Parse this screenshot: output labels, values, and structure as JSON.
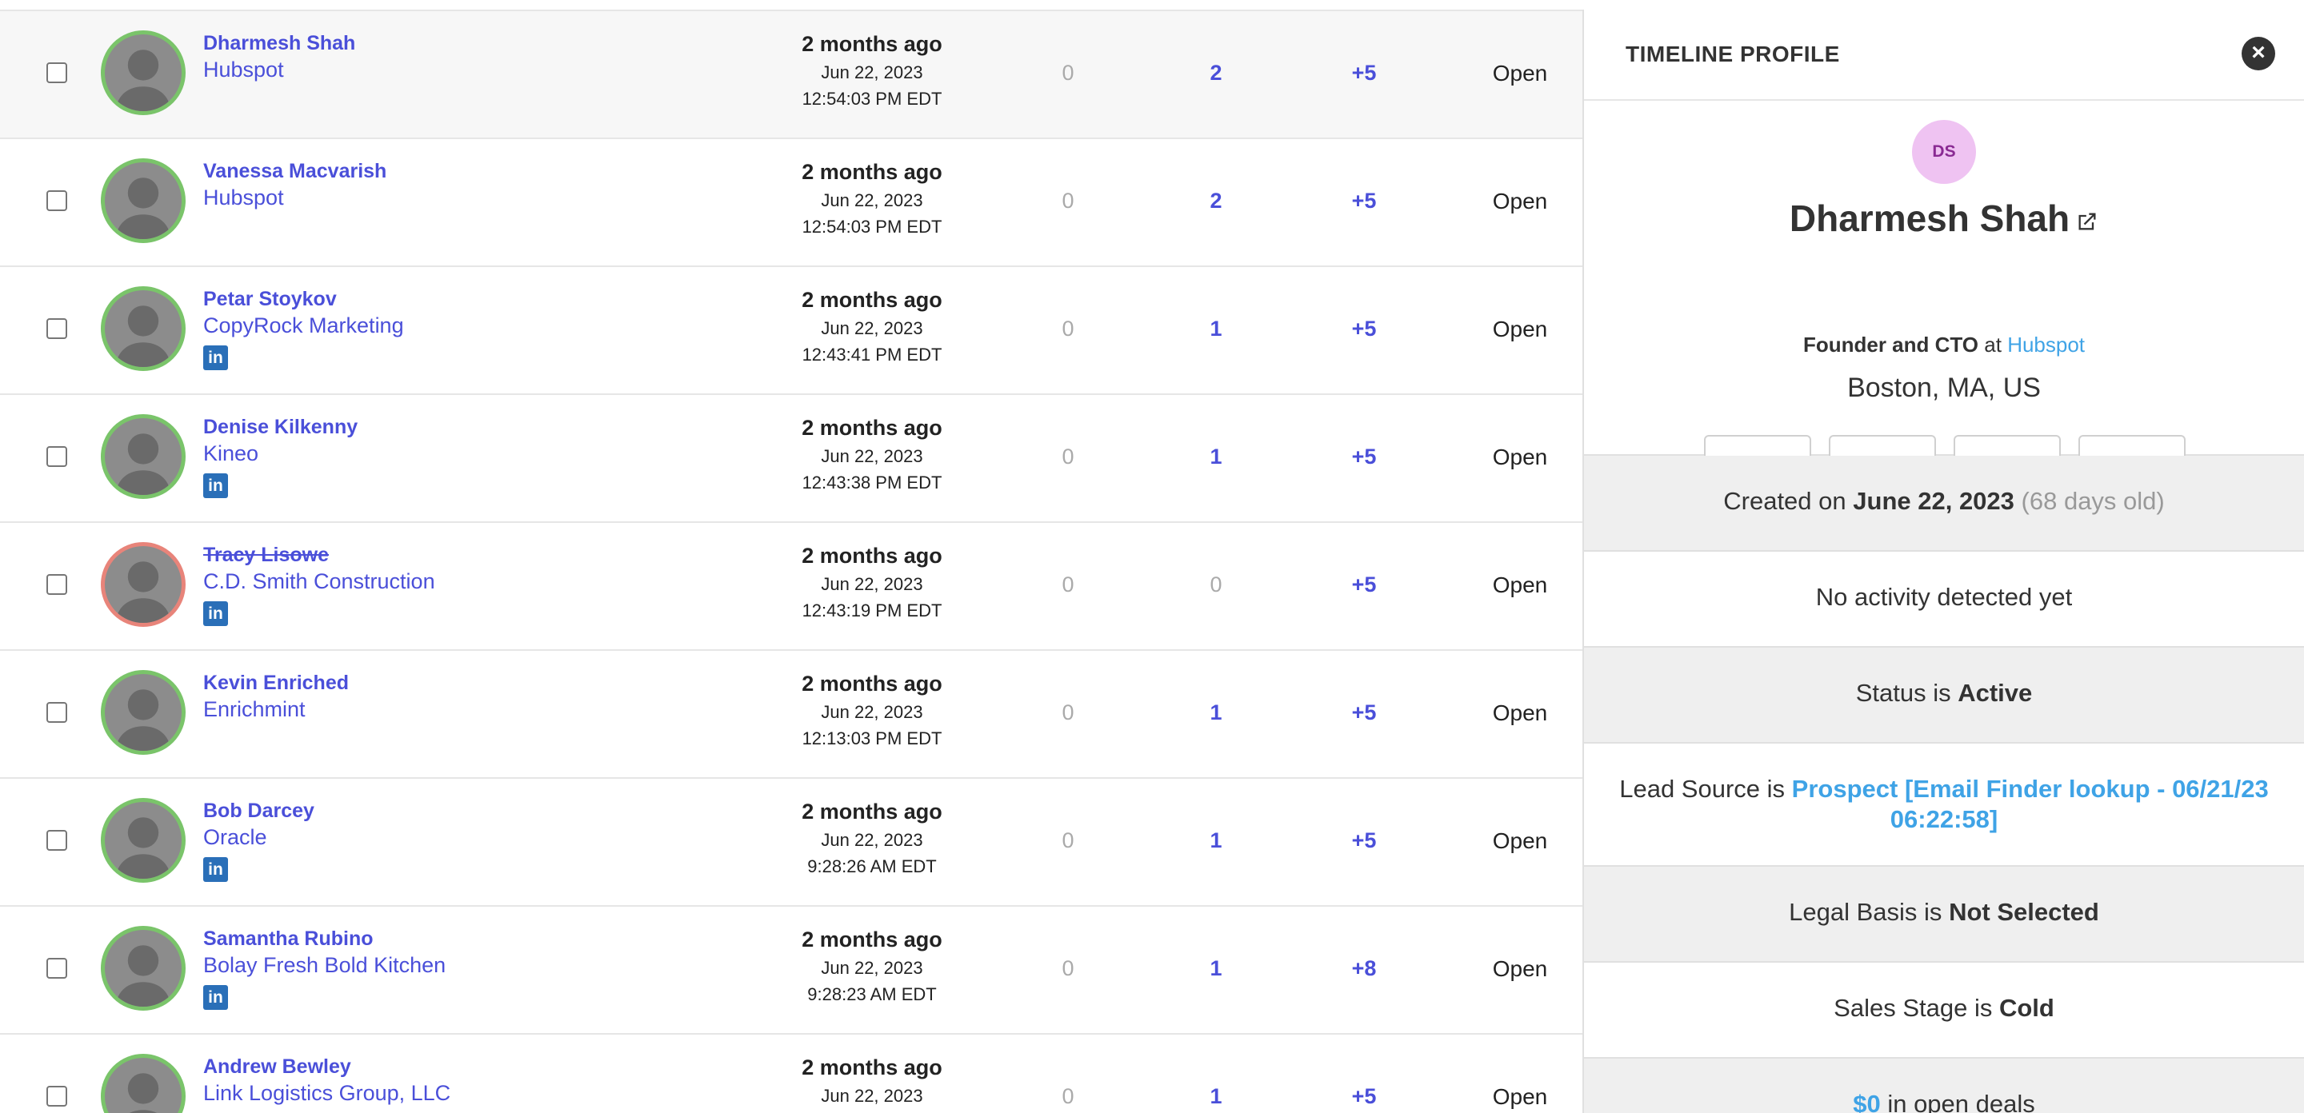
{
  "rows": [
    {
      "name": "Dharmesh Shah",
      "company": "Hubspot",
      "linkedin": false,
      "ago": "2 months ago",
      "date": "Jun 22, 2023",
      "time": "12:54:03 PM EDT",
      "c1": "0",
      "c2": "2",
      "c3": "+5",
      "status": "Open"
    },
    {
      "name": "Vanessa Macvarish",
      "company": "Hubspot",
      "linkedin": false,
      "ago": "2 months ago",
      "date": "Jun 22, 2023",
      "time": "12:54:03 PM EDT",
      "c1": "0",
      "c2": "2",
      "c3": "+5",
      "status": "Open"
    },
    {
      "name": "Petar Stoykov",
      "company": "CopyRock Marketing",
      "linkedin": true,
      "ago": "2 months ago",
      "date": "Jun 22, 2023",
      "time": "12:43:41 PM EDT",
      "c1": "0",
      "c2": "1",
      "c3": "+5",
      "status": "Open"
    },
    {
      "name": "Denise Kilkenny",
      "company": "Kineo",
      "linkedin": true,
      "ago": "2 months ago",
      "date": "Jun 22, 2023",
      "time": "12:43:38 PM EDT",
      "c1": "0",
      "c2": "1",
      "c3": "+5",
      "status": "Open"
    },
    {
      "name": "Tracy Lisowe",
      "company": "C.D. Smith Construction",
      "linkedin": true,
      "ago": "2 months ago",
      "date": "Jun 22, 2023",
      "time": "12:43:19 PM EDT",
      "c1": "0",
      "c2": "0",
      "c3": "+5",
      "status": "Open"
    },
    {
      "name": "Kevin Enriched",
      "company": "Enrichmint",
      "linkedin": false,
      "ago": "2 months ago",
      "date": "Jun 22, 2023",
      "time": "12:13:03 PM EDT",
      "c1": "0",
      "c2": "1",
      "c3": "+5",
      "status": "Open"
    },
    {
      "name": "Bob Darcey",
      "company": "Oracle",
      "linkedin": true,
      "ago": "2 months ago",
      "date": "Jun 22, 2023",
      "time": "9:28:26 AM EDT",
      "c1": "0",
      "c2": "1",
      "c3": "+5",
      "status": "Open"
    },
    {
      "name": "Samantha Rubino",
      "company": "Bolay Fresh Bold Kitchen",
      "linkedin": true,
      "ago": "2 months ago",
      "date": "Jun 22, 2023",
      "time": "9:28:23 AM EDT",
      "c1": "0",
      "c2": "1",
      "c3": "+8",
      "status": "Open"
    },
    {
      "name": "Andrew Bewley",
      "company": "Link Logistics Group, LLC",
      "linkedin": true,
      "ago": "2 months ago",
      "date": "Jun 22, 2023",
      "time": "",
      "c1": "0",
      "c2": "1",
      "c3": "+5",
      "status": "Open"
    }
  ],
  "linkedin_glyph": "in",
  "panel": {
    "title": "TIMELINE PROFILE",
    "close": "×",
    "initials": "DS",
    "name": "Dharmesh Shah",
    "role": "Founder and CTO",
    "at": "at",
    "company": "Hubspot",
    "location": "Boston, MA, US",
    "actions": [
      "rocket-icon",
      "sequence-icon",
      "envelope-icon",
      "phone-icon"
    ],
    "created_prefix": "Created on",
    "created_date": "June 22, 2023",
    "created_age": "(68 days old)",
    "activity": "No activity detected yet",
    "status_prefix": "Status is",
    "status_value": "Active",
    "lead_prefix": "Lead Source is",
    "lead_value": "Prospect [Email Finder lookup - 06/21/23 06:22:58]",
    "legal_prefix": "Legal Basis is",
    "legal_value": "Not Selected",
    "stage_prefix": "Sales Stage is",
    "stage_value": "Cold",
    "deals_amount": "$0",
    "deals_suffix": "in open deals"
  },
  "colors": {
    "accent": "#4a4fd9",
    "link": "#3fa3e6",
    "avatar_ring_ok": "#7ac46a",
    "avatar_ring_bad": "#e8847a"
  }
}
